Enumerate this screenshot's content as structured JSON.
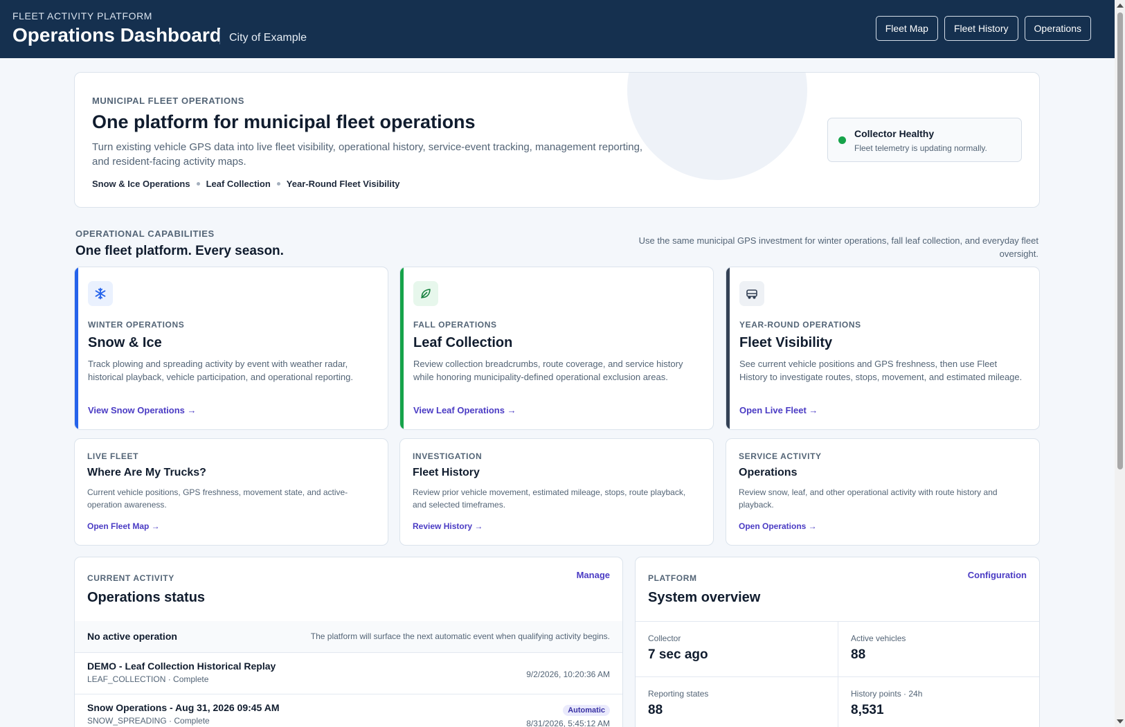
{
  "header": {
    "eyebrow": "FLEET ACTIVITY PLATFORM",
    "title": "Operations Dashboard",
    "city": "City of Example",
    "nav": [
      "Fleet Map",
      "Fleet History",
      "Operations"
    ]
  },
  "hero": {
    "eyebrow": "MUNICIPAL FLEET OPERATIONS",
    "title": "One platform for municipal fleet operations",
    "description": "Turn existing vehicle GPS data into live fleet visibility, operational history, service-event tracking, management reporting, and resident-facing activity maps.",
    "tags": [
      "Snow & Ice Operations",
      "Leaf Collection",
      "Year-Round Fleet Visibility"
    ],
    "status": {
      "title": "Collector Healthy",
      "text": "Fleet telemetry is updating normally.",
      "color": "#16a34a"
    }
  },
  "capabilities": {
    "eyebrow": "OPERATIONAL CAPABILITIES",
    "title": "One fleet platform. Every season.",
    "note": "Use the same municipal GPS investment for winter operations, fall leaf collection, and everyday fleet oversight.",
    "cards": [
      {
        "icon": "snowflake-icon",
        "eyebrow": "WINTER OPERATIONS",
        "title": "Snow & Ice",
        "description": "Track plowing and spreading activity by event with weather radar, historical playback, vehicle participation, and operational reporting.",
        "link": "View Snow Operations →",
        "accent": "#2563eb"
      },
      {
        "icon": "leaf-icon",
        "eyebrow": "FALL OPERATIONS",
        "title": "Leaf Collection",
        "description": "Review collection breadcrumbs, route coverage, and service history while honoring municipality-defined operational exclusion areas.",
        "link": "View Leaf Operations →",
        "accent": "#16a34a"
      },
      {
        "icon": "truck-icon",
        "eyebrow": "YEAR-ROUND OPERATIONS",
        "title": "Fleet Visibility",
        "description": "See current vehicle positions and GPS freshness, then use Fleet History to investigate routes, stops, movement, and estimated mileage.",
        "link": "Open Live Fleet →",
        "accent": "#334155"
      }
    ],
    "links": [
      {
        "eyebrow": "LIVE FLEET",
        "title": "Where Are My Trucks?",
        "description": "Current vehicle positions, GPS freshness, movement state, and active-operation awareness.",
        "link": "Open Fleet Map →"
      },
      {
        "eyebrow": "INVESTIGATION",
        "title": "Fleet History",
        "description": "Review prior vehicle movement, estimated mileage, stops, route playback, and selected timeframes.",
        "link": "Review History →"
      },
      {
        "eyebrow": "SERVICE ACTIVITY",
        "title": "Operations",
        "description": "Review snow, leaf, and other operational activity with route history and playback.",
        "link": "Open Operations →"
      }
    ]
  },
  "operations": {
    "eyebrow": "CURRENT ACTIVITY",
    "title": "Operations status",
    "action": "Manage",
    "no_active": "No active operation",
    "no_active_note": "The platform will surface the next automatic event when qualifying activity begins.",
    "rows": [
      {
        "name": "DEMO - Leaf Collection Historical Replay",
        "sub": "LEAF_COLLECTION · Complete",
        "time": "9/2/2026, 10:20:36 AM",
        "badge": ""
      },
      {
        "name": "Snow Operations - Aug 31, 2026 09:45 AM",
        "sub": "SNOW_SPREADING · Complete",
        "time": "8/31/2026, 5:45:12 AM",
        "badge": "Automatic"
      }
    ]
  },
  "platform": {
    "eyebrow": "PLATFORM",
    "title": "System overview",
    "action": "Configuration",
    "stats": [
      {
        "label": "Collector",
        "value": "7 sec ago"
      },
      {
        "label": "Active vehicles",
        "value": "88"
      },
      {
        "label": "Reporting states",
        "value": "88"
      },
      {
        "label": "History points · 24h",
        "value": "8,531"
      }
    ]
  }
}
